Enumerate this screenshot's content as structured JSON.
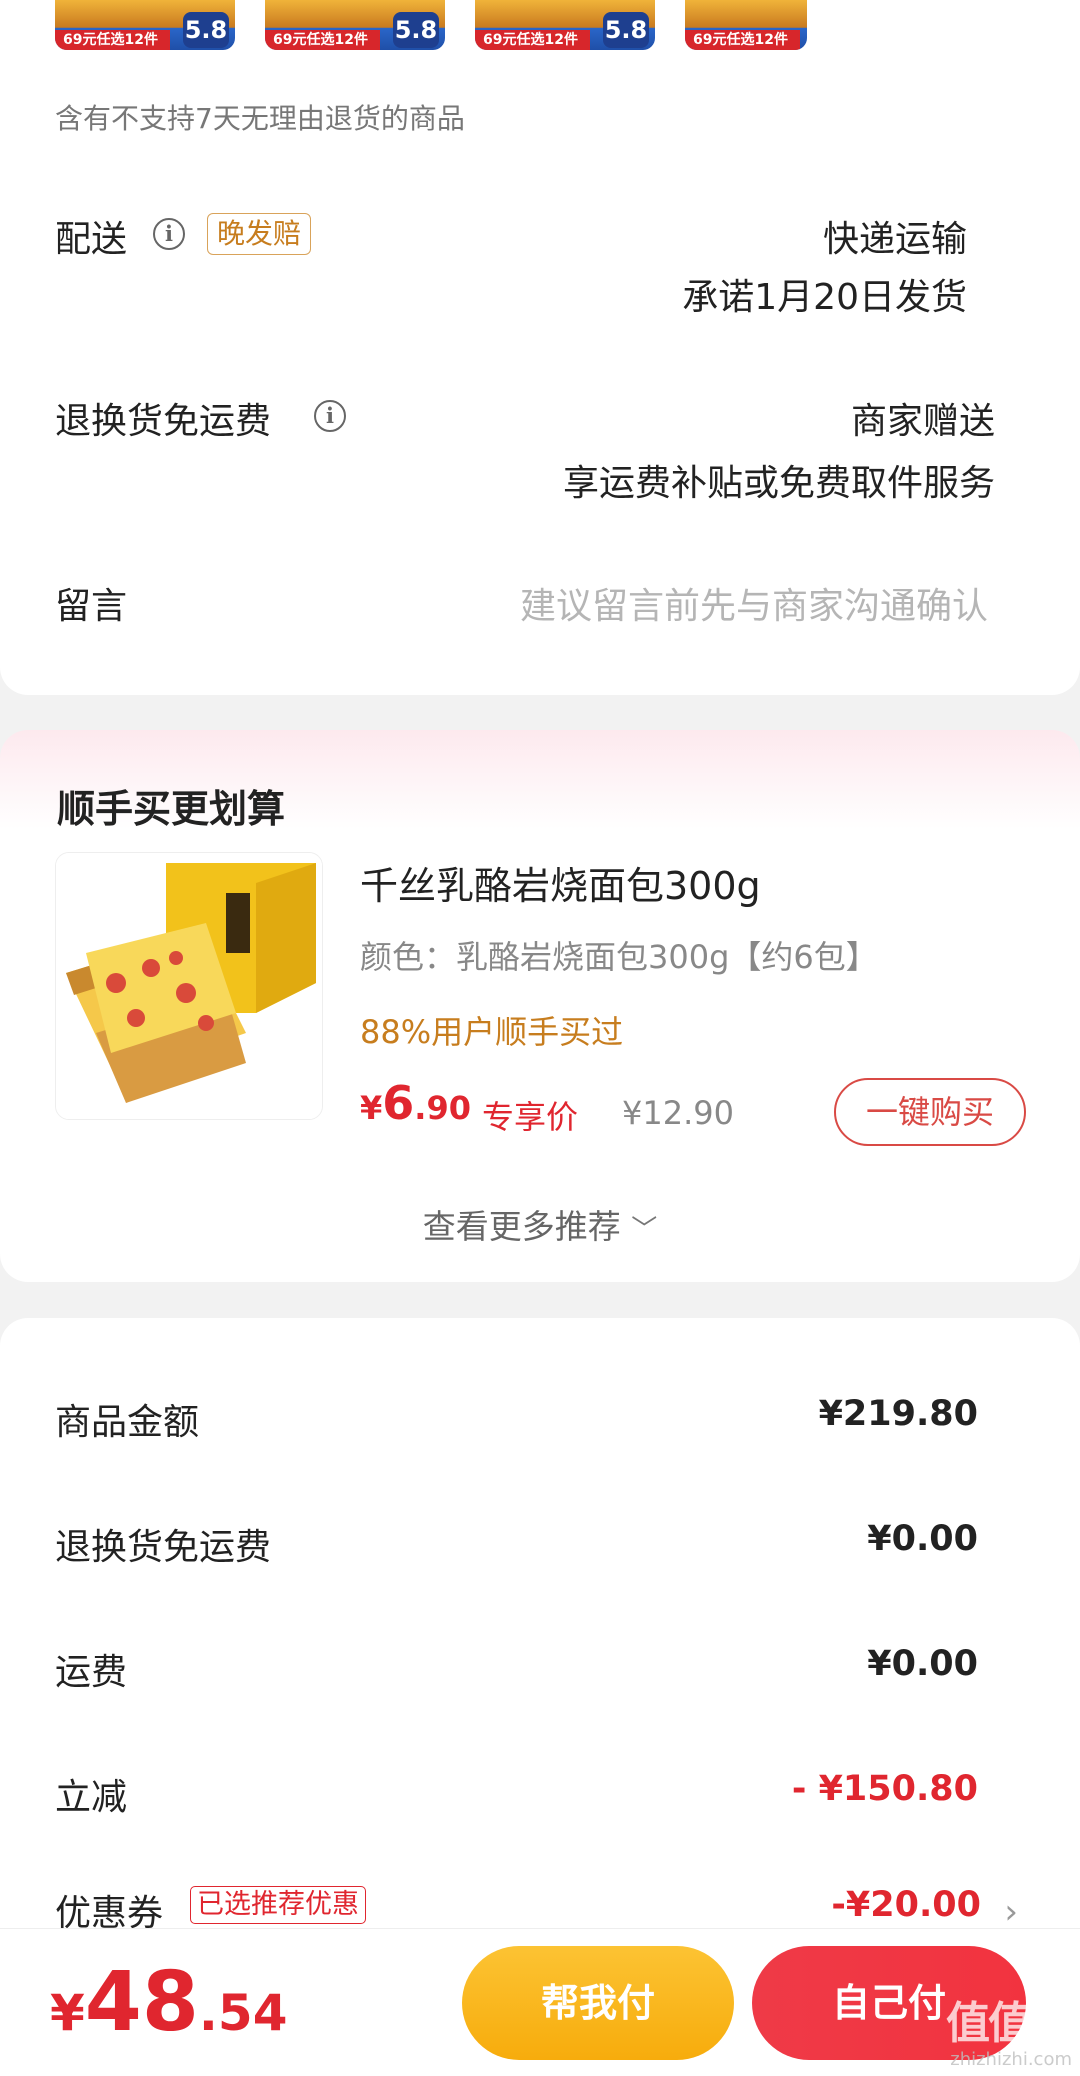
{
  "thumbnails": [
    {
      "promo": "69元任选12件",
      "badge": "5.8"
    },
    {
      "promo": "69元任选12件",
      "badge": "5.8"
    },
    {
      "promo": "69元任选12件",
      "badge": "5.8"
    },
    {
      "promo": "69元任选12件",
      "badge": ""
    }
  ],
  "notice": "含有不支持7天无理由退货的商品",
  "delivery": {
    "label": "配送",
    "tag": "晚发赔",
    "method": "快递运输",
    "promise": "承诺1月20日发货"
  },
  "return_shipping": {
    "label": "退换货免运费",
    "value_line1": "商家赠送",
    "value_line2": "享运费补贴或免费取件服务"
  },
  "message": {
    "label": "留言",
    "placeholder": "建议留言前先与商家沟通确认"
  },
  "recommend": {
    "title": "顺手买更划算",
    "product": {
      "name": "千丝乳酪岩烧面包300g",
      "spec": "颜色：乳酪岩烧面包300g【约6包】",
      "hint": "88%用户顺手买过",
      "price_symbol": "¥",
      "price_int": "6",
      "price_dec": ".90",
      "exclusive_label": "专享价",
      "original_price": "¥12.90",
      "buy_button": "一键购买"
    },
    "more": "查看更多推荐"
  },
  "summary": {
    "goods_amount": {
      "label": "商品金额",
      "value": "¥219.80"
    },
    "return_shipping": {
      "label": "退换货免运费",
      "value": "¥0.00"
    },
    "shipping": {
      "label": "运费",
      "value": "¥0.00"
    },
    "discount": {
      "label": "立减",
      "value": "- ¥150.80"
    },
    "coupon": {
      "label": "优惠券",
      "tag": "已选推荐优惠",
      "value": "-¥20.00"
    }
  },
  "bottom": {
    "total_symbol": "¥",
    "total_int": "48",
    "total_dec": ".54",
    "help_pay": "帮我付",
    "self_pay": "自己付",
    "watermark": "值值值",
    "watermark_site": "zhizhizhi.com"
  },
  "colors": {
    "accent_red": "#e0262f",
    "accent_orange": "#c77d1e",
    "help_button": "#f7ac0c"
  }
}
